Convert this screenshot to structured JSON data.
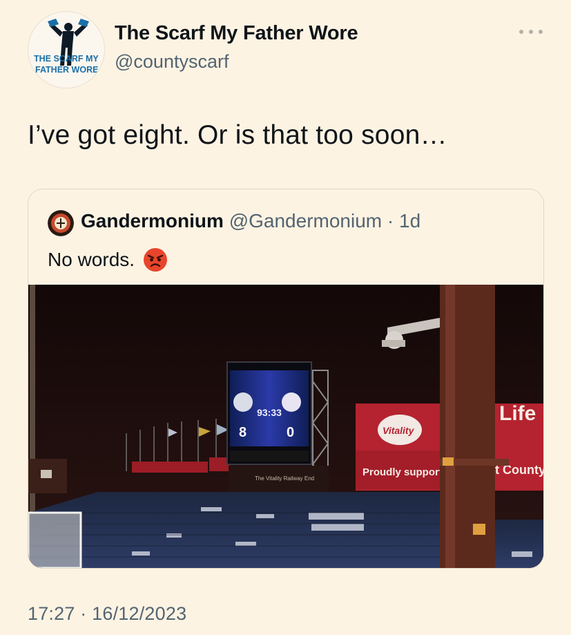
{
  "author": {
    "display_name": "The Scarf My Father Wore",
    "handle": "@countyscarf",
    "avatar_text_line1": "THE SCARF MY",
    "avatar_text_line2": "FATHER WORE"
  },
  "tweet": {
    "text": "I’ve got eight. Or is that too soon…",
    "timestamp": "17:27 · 16/12/2023"
  },
  "quoted_tweet": {
    "display_name": "Gandermonium",
    "handle": "@Gandermonium",
    "separator": "·",
    "time": "1d",
    "text": "No words.",
    "emoji": "angry-face",
    "image": {
      "scoreboard_home": "8",
      "scoreboard_away": "0",
      "scoreboard_time": "93:33",
      "stand_name": "The Vitality Railway End",
      "banner_brand": "Vitality",
      "banner_text_1": "Proudly supporting",
      "banner_text_2": "Life",
      "banner_text_3": "t County"
    }
  },
  "colors": {
    "background": "#fdf3e3",
    "text_primary": "#0f1419",
    "text_secondary": "#536471",
    "vitality_red": "#b4232f"
  },
  "icons": [
    "more-icon",
    "angry-face-emoji"
  ]
}
